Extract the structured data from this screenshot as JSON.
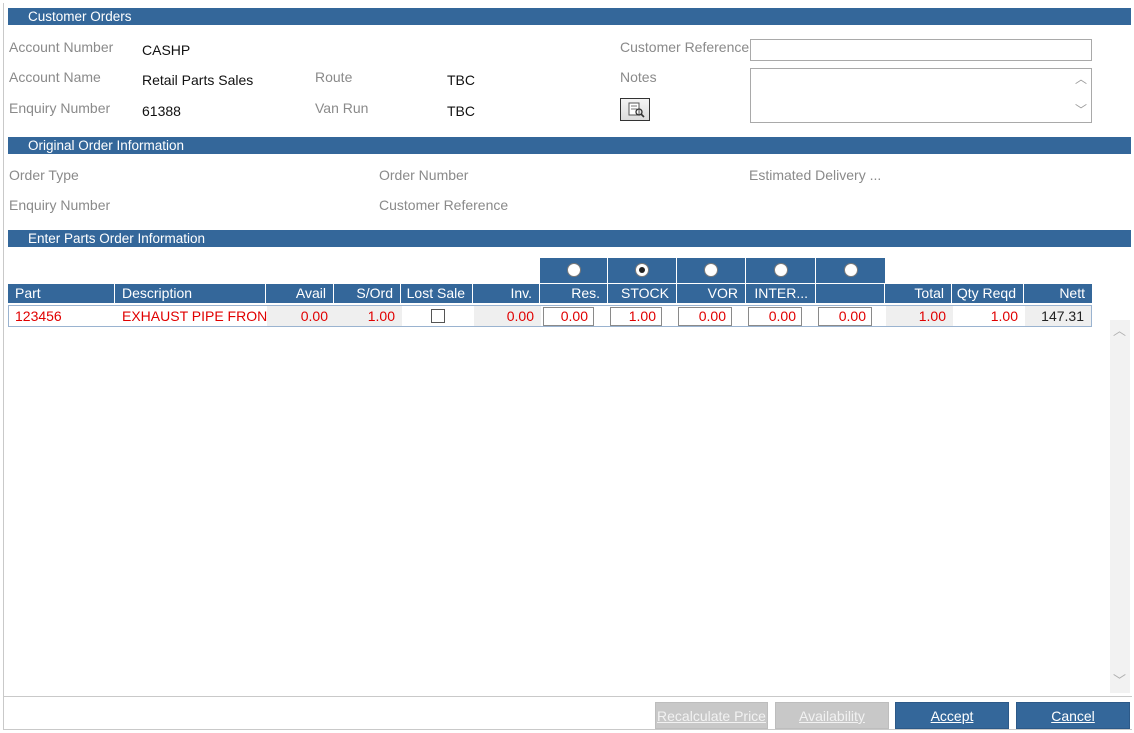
{
  "sections": {
    "customer_orders": "Customer Orders",
    "original_order": "Original Order Information",
    "parts_order": "Enter Parts Order Information"
  },
  "customer": {
    "account_number_label": "Account Number",
    "account_number": "CASHP",
    "account_name_label": "Account Name",
    "account_name": "Retail Parts Sales",
    "enquiry_number_label": "Enquiry Number",
    "enquiry_number": "61388",
    "route_label": "Route",
    "route": "TBC",
    "van_run_label": "Van Run",
    "van_run": "TBC",
    "customer_reference_label": "Customer Reference",
    "customer_reference": "",
    "notes_label": "Notes",
    "notes": ""
  },
  "original_order": {
    "order_type_label": "Order Type",
    "enquiry_number_label": "Enquiry Number",
    "order_number_label": "Order Number",
    "customer_reference_label": "Customer Reference",
    "estimated_delivery_label": "Estimated Delivery ..."
  },
  "grid": {
    "radio_selected": "STOCK",
    "columns": [
      "Part",
      "Description",
      "Avail",
      "S/Ord",
      "Lost Sale",
      "Inv.",
      "Res.",
      "STOCK",
      "VOR",
      "INTER...",
      "",
      "Total",
      "Qty Reqd",
      "Nett"
    ],
    "rows": [
      {
        "part": "123456",
        "description": "EXHAUST PIPE FRONT",
        "avail": "0.00",
        "s_ord": "1.00",
        "lost_sale": false,
        "inv": "0.00",
        "res": "0.00",
        "stock": "1.00",
        "vor": "0.00",
        "inter": "0.00",
        "extra": "0.00",
        "total": "1.00",
        "qty_reqd": "1.00",
        "nett": "147.31"
      }
    ]
  },
  "buttons": {
    "recalculate": "Recalculate Price",
    "availability": "Availability",
    "accept": "Accept",
    "cancel": "Cancel"
  },
  "colors": {
    "header_blue": "#34679a",
    "row_text_red": "#e00000",
    "disabled_grey": "#c8c8c8"
  }
}
